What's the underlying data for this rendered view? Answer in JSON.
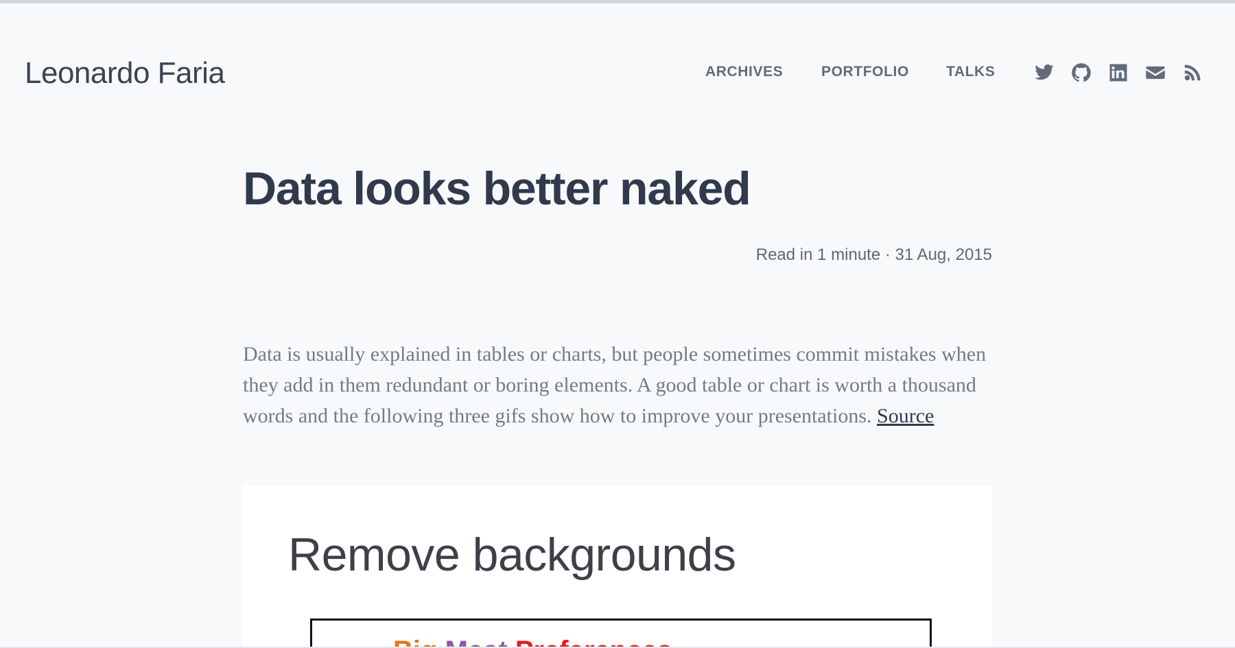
{
  "header": {
    "brand": "Leonardo Faria",
    "nav": [
      "ARCHIVES",
      "PORTFOLIO",
      "TALKS"
    ],
    "social_icons": [
      "twitter-icon",
      "github-icon",
      "linkedin-icon",
      "email-icon",
      "rss-icon"
    ]
  },
  "post": {
    "title": "Data looks better naked",
    "meta": "Read in 1 minute · 31 Aug, 2015",
    "paragraph": "Data is usually explained in tables or charts, but people sometimes commit mistakes when they add in them redundant or boring elements. A good table or chart is worth a thousand words and the following three gifs show how to improve your presentations.",
    "source_link": "Source"
  },
  "figure": {
    "heading": "Remove backgrounds",
    "caption_words": [
      "Big",
      "Meat",
      "Preferences"
    ]
  },
  "colors": {
    "background": "#f8f9fb",
    "text_dark": "#303a4d",
    "text_muted": "#747a86",
    "nav": "#626b7a"
  }
}
